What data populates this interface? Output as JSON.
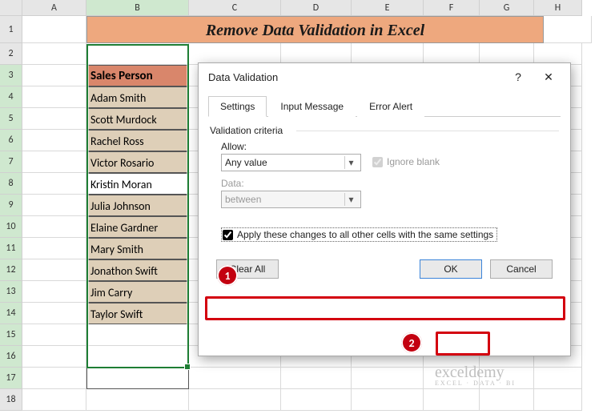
{
  "columns": [
    "A",
    "B",
    "C",
    "D",
    "E",
    "F",
    "G",
    "H"
  ],
  "selected_col": "B",
  "row_nums": [
    1,
    2,
    3,
    4,
    5,
    6,
    7,
    8,
    9,
    10,
    11,
    12,
    13,
    14,
    15,
    16,
    17,
    18
  ],
  "selected_rows_start": 3,
  "selected_rows_end": 17,
  "title": "Remove Data Validation in Excel",
  "header_cell": "Sales Person",
  "data": [
    "Adam Smith",
    "Scott Murdock",
    "Rachel Ross",
    "Victor Rosario",
    "Kristin Moran",
    "Julia Johnson",
    "Elaine Gardner",
    "Mary Smith",
    "Jonathon Swift",
    "Jim Carry",
    "Taylor Swift"
  ],
  "active_row_index": 4,
  "dialog": {
    "title": "Data Validation",
    "tabs": [
      "Settings",
      "Input Message",
      "Error Alert"
    ],
    "active_tab": 0,
    "criteria_label": "Validation criteria",
    "allow_label": "Allow:",
    "allow_value": "Any value",
    "ignore_blank": "Ignore blank",
    "ignore_blank_checked": true,
    "data_label": "Data:",
    "data_value": "between",
    "apply_label": "Apply these changes to all other cells with the same settings",
    "apply_checked": true,
    "clear_all": "Clear All",
    "ok": "OK",
    "cancel": "Cancel"
  },
  "annotations": {
    "badge1": "1",
    "badge2": "2"
  },
  "watermark": {
    "main": "exceldemy",
    "sub": "EXCEL · DATA · BI"
  }
}
